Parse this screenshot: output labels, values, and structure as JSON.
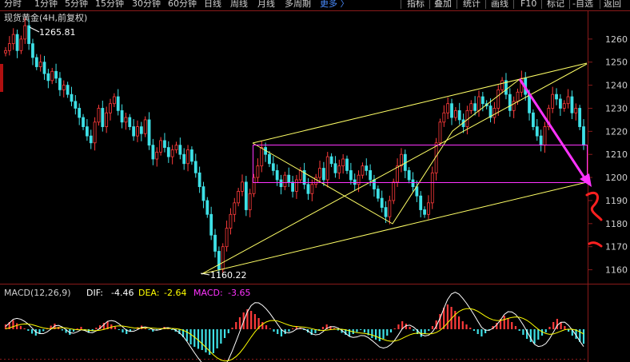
{
  "toolbar": {
    "periods": [
      "分时",
      "1分钟",
      "5分钟",
      "15分钟",
      "30分钟",
      "60分钟",
      "日线",
      "周线",
      "月线",
      "多周期"
    ],
    "more": "更多 〉",
    "right_buttons": [
      "指标",
      "叠加",
      "统计",
      "画线",
      "F10",
      "标记",
      "-自选",
      "返回"
    ]
  },
  "chart": {
    "title": "现货黄金(4H,前复权)",
    "high_label": "1265.81",
    "low_label": "1160.22",
    "price_ticks": [
      "1260",
      "1250",
      "1240",
      "1230",
      "1220",
      "1210",
      "1200",
      "1190",
      "1180",
      "1170",
      "1160"
    ],
    "colors": {
      "up": "#ff3b3b",
      "down": "#3ee0e6",
      "channel": "#ffff66",
      "box": "#ff33ff",
      "arrow": "#ff33ff",
      "annotation": "#ff2020"
    }
  },
  "macd": {
    "name": "MACD(12,26,9)",
    "dif_label": "DIF:",
    "dif_value": "-4.46",
    "dea_label": "DEA:",
    "dea_value": "-2.64",
    "macd_label": "MACD:",
    "macd_value": "-3.65",
    "colors": {
      "name": "#cfcfcf",
      "dif": "#ffffff",
      "dea": "#ffff00",
      "macd": "#ff33ff"
    }
  },
  "chart_data": {
    "type": "candlestick",
    "instrument": "现货黄金",
    "timeframe": "4H",
    "ylim": [
      1155,
      1270
    ],
    "close": [
      1255,
      1258,
      1262,
      1255,
      1260,
      1265.81,
      1258,
      1252,
      1248,
      1250,
      1245,
      1242,
      1246,
      1243,
      1238,
      1240,
      1236,
      1233,
      1230,
      1226,
      1222,
      1218,
      1215,
      1224,
      1230,
      1222,
      1228,
      1232,
      1235,
      1229,
      1224,
      1226,
      1222,
      1218,
      1222,
      1219,
      1225,
      1214,
      1208,
      1211,
      1216,
      1213,
      1209,
      1212,
      1214,
      1210,
      1206,
      1212,
      1207,
      1202,
      1196,
      1190,
      1184,
      1175,
      1168,
      1160.22,
      1170,
      1178,
      1184,
      1189,
      1194,
      1198,
      1186,
      1193,
      1200,
      1205,
      1213,
      1210,
      1206,
      1203,
      1199,
      1196,
      1201,
      1198,
      1194,
      1199,
      1203,
      1197,
      1193,
      1197,
      1200,
      1204,
      1199,
      1209,
      1206,
      1202,
      1205,
      1208,
      1203,
      1199,
      1197,
      1201,
      1205,
      1203,
      1199,
      1195,
      1191,
      1187,
      1183,
      1190,
      1198,
      1205,
      1210,
      1203,
      1199,
      1196,
      1192,
      1186,
      1184,
      1189,
      1202,
      1215,
      1224,
      1228,
      1232,
      1226,
      1229,
      1225,
      1222,
      1229,
      1232,
      1229,
      1235,
      1232,
      1231,
      1226,
      1230,
      1238,
      1242,
      1236,
      1229,
      1233,
      1237,
      1243,
      1236,
      1228,
      1222,
      1218,
      1214,
      1222,
      1230,
      1236,
      1234,
      1230,
      1232,
      1235,
      1228,
      1230,
      1222,
      1214
    ],
    "macd_hist": [
      1.2,
      1.8,
      2.3,
      1.5,
      0.8,
      0.2,
      -0.4,
      -1.1,
      -1.6,
      -1.0,
      -0.5,
      0.3,
      0.9,
      1.4,
      0.6,
      -0.3,
      -0.9,
      -1.4,
      -0.6,
      0.2,
      0.6,
      -0.4,
      -0.9,
      -0.5,
      0.4,
      1.0,
      1.6,
      2.0,
      1.2,
      0.6,
      -0.2,
      -0.8,
      -1.2,
      -0.6,
      -0.1,
      0.5,
      0.9,
      0.4,
      -0.2,
      -0.6,
      -0.3,
      0.2,
      0.6,
      0.3,
      -0.2,
      -0.6,
      -1.2,
      -2.0,
      -3.0,
      -3.8,
      -4.4,
      -4.9,
      -5.2,
      -5.8,
      -6.4,
      -6.0,
      -4.8,
      -3.6,
      -2.2,
      -1.0,
      0.4,
      1.8,
      3.0,
      4.2,
      5.0,
      4.6,
      3.8,
      2.8,
      1.8,
      1.0,
      0.2,
      -0.6,
      -1.2,
      -1.8,
      -1.2,
      -0.6,
      0.2,
      0.8,
      0.4,
      -0.2,
      -0.8,
      -1.4,
      -1.0,
      -0.4,
      0.6,
      1.2,
      0.8,
      0.3,
      -0.3,
      -0.9,
      -1.4,
      -1.8,
      -1.2,
      -0.7,
      -0.2,
      -0.8,
      -1.5,
      -2.2,
      -2.6,
      -3.0,
      -2.4,
      -1.6,
      -0.8,
      0.2,
      1.2,
      2.0,
      1.4,
      0.6,
      -0.4,
      -1.2,
      -1.9,
      -1.2,
      -0.4,
      0.8,
      2.2,
      3.8,
      5.4,
      6.2,
      5.6,
      4.6,
      3.2,
      2.0,
      1.2,
      0.4,
      -0.4,
      -1.2,
      -1.8,
      -1.0,
      -0.2,
      0.8,
      1.6,
      2.6,
      3.4,
      2.8,
      1.8,
      0.8,
      -0.4,
      -1.4,
      -2.4,
      -3.2,
      -3.6,
      -2.6,
      -1.6,
      -0.8,
      0.6,
      1.8,
      2.6,
      1.8,
      0.8,
      -0.6,
      -1.6,
      -2.4,
      -3.2,
      -3.65
    ]
  }
}
